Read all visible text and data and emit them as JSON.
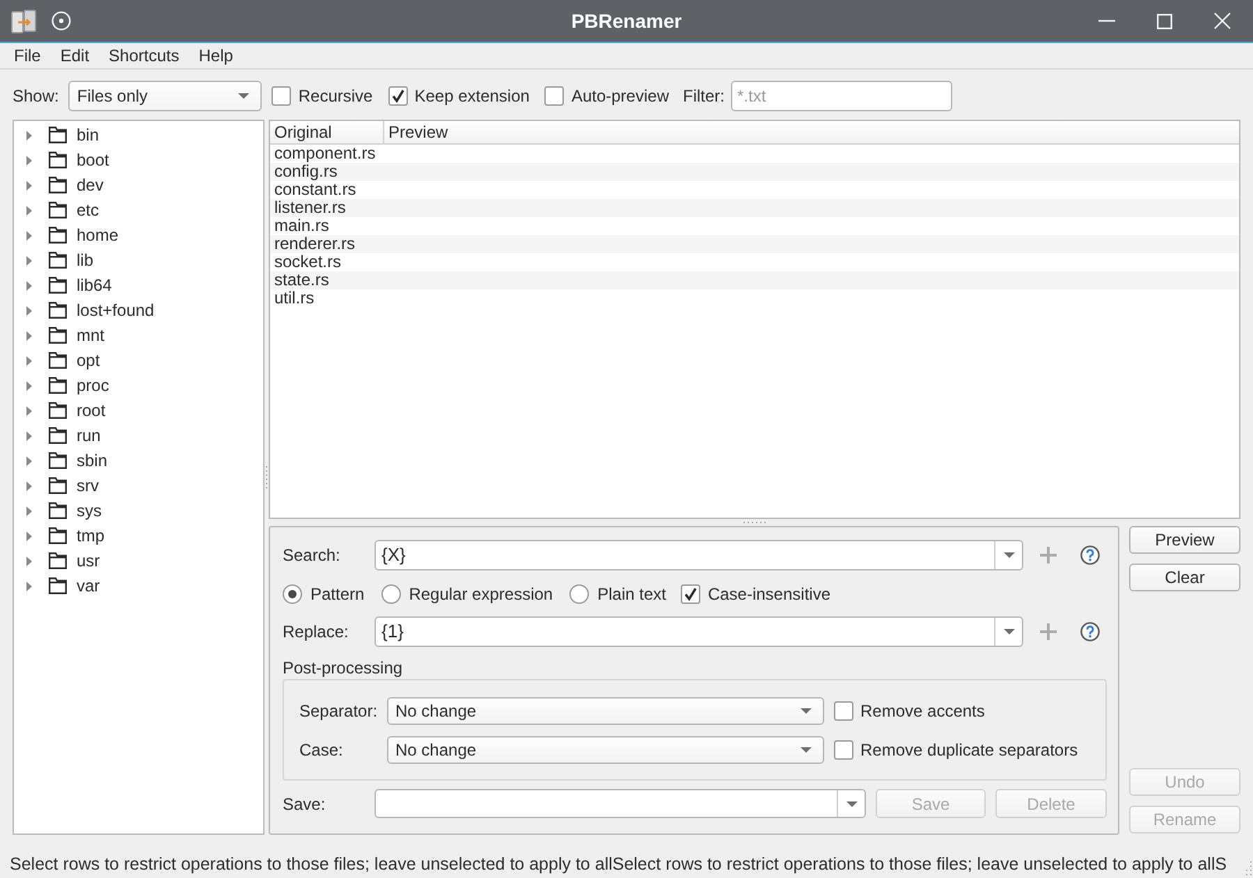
{
  "window": {
    "title": "PBRenamer"
  },
  "menu": [
    "File",
    "Edit",
    "Shortcuts",
    "Help"
  ],
  "toolbar": {
    "show": {
      "label": "Show:",
      "value": "Files only"
    },
    "options": [
      {
        "label": "Recursive",
        "checked": false
      },
      {
        "label": "Keep extension",
        "checked": true
      },
      {
        "label": "Auto-preview",
        "checked": false
      }
    ],
    "filter": {
      "label": "Filter:",
      "placeholder": "*.txt"
    }
  },
  "tree": {
    "items": [
      {
        "label": "bin",
        "expanded": false
      },
      {
        "label": "boot",
        "expanded": false
      },
      {
        "label": "dev",
        "expanded": false
      },
      {
        "label": "etc",
        "expanded": false
      },
      {
        "label": "home",
        "expanded": false
      },
      {
        "label": "lib",
        "expanded": false
      },
      {
        "label": "lib64",
        "expanded": false
      },
      {
        "label": "lost+found",
        "expanded": false
      },
      {
        "label": "mnt",
        "expanded": false
      },
      {
        "label": "opt",
        "expanded": false
      },
      {
        "label": "proc",
        "expanded": false
      },
      {
        "label": "root",
        "expanded": false
      },
      {
        "label": "run",
        "expanded": false
      },
      {
        "label": "sbin",
        "expanded": false
      },
      {
        "label": "srv",
        "expanded": false
      },
      {
        "label": "sys",
        "expanded": false
      },
      {
        "label": "tmp",
        "expanded": false
      },
      {
        "label": "usr",
        "expanded": false
      },
      {
        "label": "var",
        "expanded": false
      }
    ]
  },
  "table": {
    "columns": [
      "Original",
      "Preview"
    ],
    "rows": [
      {
        "original": "component.rs"
      },
      {
        "original": "config.rs"
      },
      {
        "original": "constant.rs"
      },
      {
        "original": "listener.rs"
      },
      {
        "original": "main.rs"
      },
      {
        "original": "renderer.rs"
      },
      {
        "original": "socket.rs"
      },
      {
        "original": "state.rs"
      },
      {
        "original": "util.rs"
      }
    ]
  },
  "rename": {
    "search": {
      "label": "Search:",
      "value": "{X}"
    },
    "modes": [
      {
        "label": "Pattern",
        "selected": true
      },
      {
        "label": "Regular expression",
        "selected": false
      },
      {
        "label": "Plain text",
        "selected": false
      }
    ],
    "case_insensitive": {
      "label": "Case-insensitive",
      "checked": true
    },
    "replace": {
      "label": "Replace:",
      "value": "{1}"
    },
    "post_processing": {
      "title": "Post-processing",
      "rows": [
        {
          "label": "Separator:",
          "value": "No change",
          "option": {
            "label": "Remove accents",
            "checked": false
          }
        },
        {
          "label": "Case:",
          "value": "No change",
          "option": {
            "label": "Remove duplicate separators",
            "checked": false
          }
        }
      ]
    },
    "save": {
      "label": "Save:",
      "buttons": [
        {
          "label": "Save",
          "disabled": true
        },
        {
          "label": "Delete",
          "disabled": true
        }
      ]
    }
  },
  "actions": {
    "top": [
      {
        "label": "Preview",
        "disabled": false
      },
      {
        "label": "Clear",
        "disabled": false
      }
    ],
    "bottom": [
      {
        "label": "Undo",
        "disabled": true
      },
      {
        "label": "Rename",
        "disabled": true
      }
    ]
  },
  "status_bar": {
    "text": "Select rows to restrict operations to those files; leave unselected to apply to allSelect rows to restrict operations to those files; leave unselected to apply to allS"
  }
}
